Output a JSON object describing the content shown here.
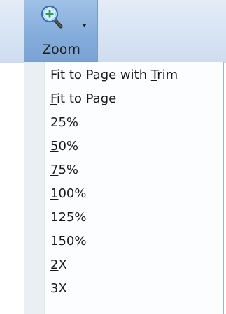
{
  "zoom_button": {
    "label": "Zoom",
    "icon": "zoom-in-magnifier-icon",
    "dropdown_icon": "dropdown-arrow-icon"
  },
  "menu": {
    "items": [
      {
        "id": "fit-to-page-with-trim",
        "pre": "Fit to Page with ",
        "mnemonic": "T",
        "post": "rim"
      },
      {
        "id": "fit-to-page",
        "pre": "",
        "mnemonic": "F",
        "post": "it to Page"
      },
      {
        "id": "25-percent",
        "pre": "25%",
        "mnemonic": "",
        "post": ""
      },
      {
        "id": "50-percent",
        "pre": "",
        "mnemonic": "5",
        "post": "0%"
      },
      {
        "id": "75-percent",
        "pre": "",
        "mnemonic": "7",
        "post": "5%"
      },
      {
        "id": "100-percent",
        "pre": "",
        "mnemonic": "1",
        "post": "00%"
      },
      {
        "id": "125-percent",
        "pre": "125%",
        "mnemonic": "",
        "post": ""
      },
      {
        "id": "150-percent",
        "pre": "150%",
        "mnemonic": "",
        "post": ""
      },
      {
        "id": "2x",
        "pre": "",
        "mnemonic": "2",
        "post": "X"
      },
      {
        "id": "3x",
        "pre": "",
        "mnemonic": "3",
        "post": "X"
      }
    ]
  },
  "colors": {
    "button_pressed": "#86addb",
    "ribbon": "#d7e4f3",
    "menu_background": "#fcfdfe",
    "menu_gutter": "#e9eff3",
    "icon_green": "#2f9a57",
    "icon_blue": "#2d6fb4"
  }
}
